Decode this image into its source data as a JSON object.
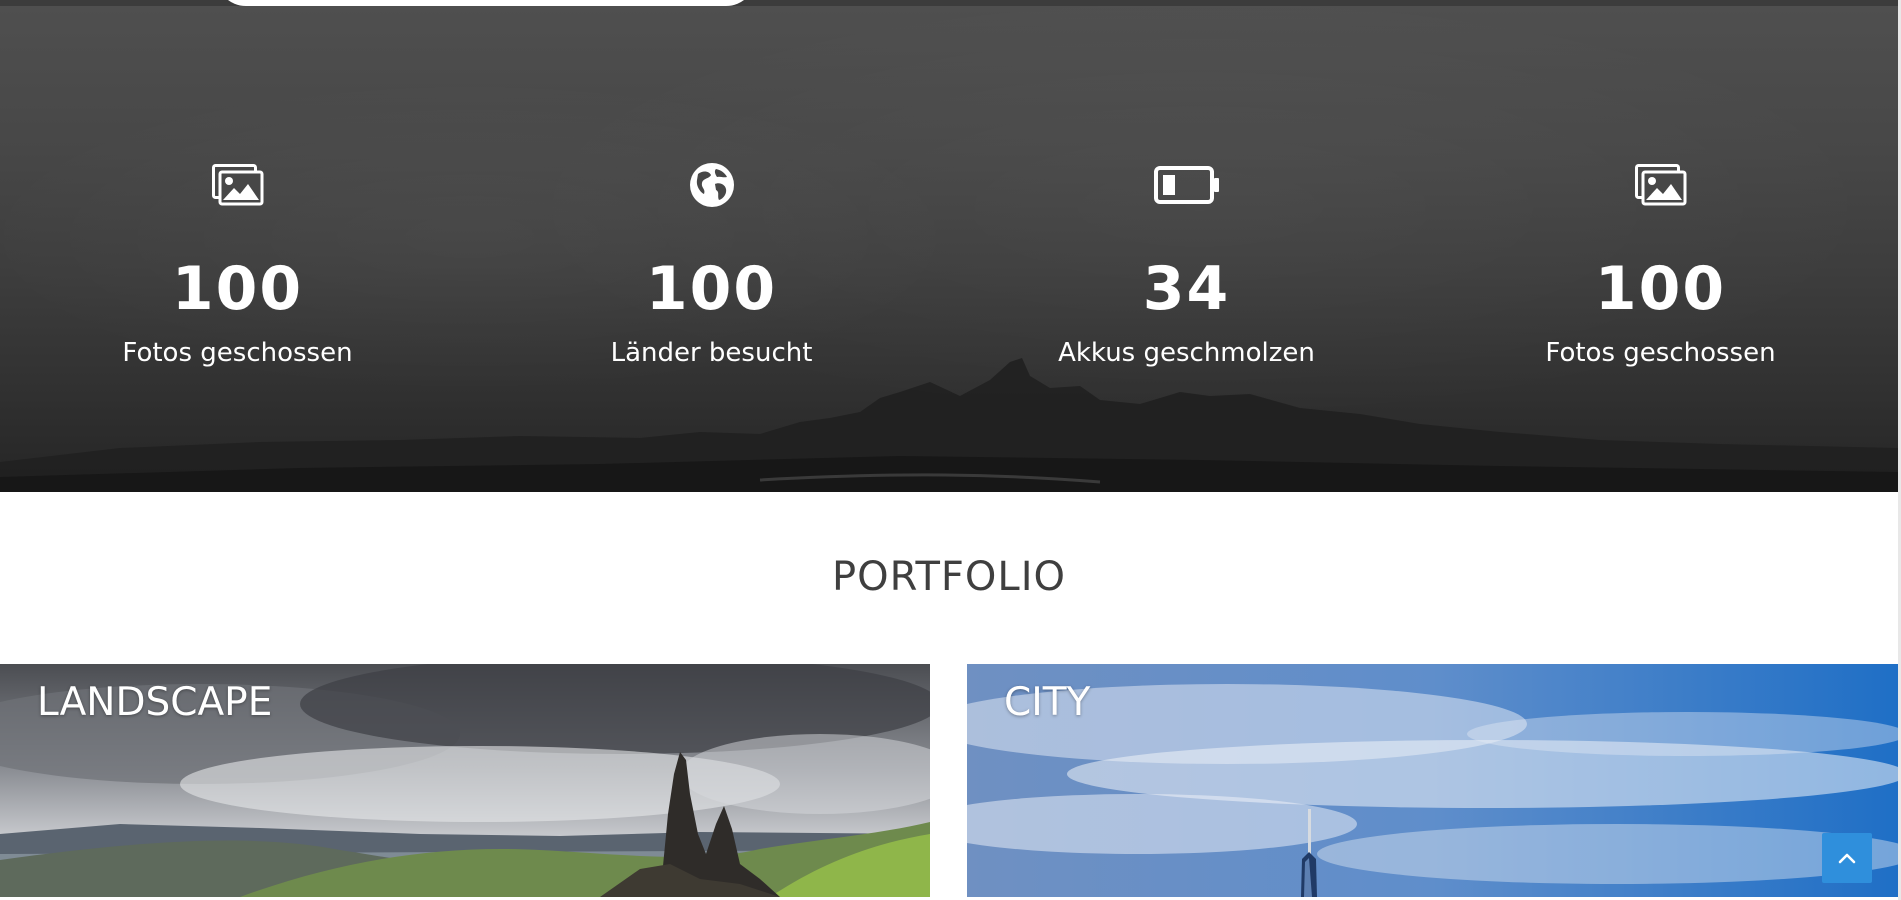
{
  "stats": [
    {
      "icon": "image-icon",
      "value": "100",
      "label": "Fotos geschossen"
    },
    {
      "icon": "globe-icon",
      "value": "100",
      "label": "Länder besucht"
    },
    {
      "icon": "battery-low-icon",
      "value": "34",
      "label": "Akkus geschmolzen"
    },
    {
      "icon": "image-icon",
      "value": "100",
      "label": "Fotos geschossen"
    }
  ],
  "portfolio": {
    "title": "PORTFOLIO",
    "cards": [
      {
        "title": "LANDSCAPE"
      },
      {
        "title": "CITY"
      }
    ]
  },
  "back_to_top": {
    "icon": "chevron-up-icon"
  },
  "colors": {
    "stats_background": "#474747",
    "accent": "#2f8fdc",
    "heading": "#3f3f3f"
  }
}
